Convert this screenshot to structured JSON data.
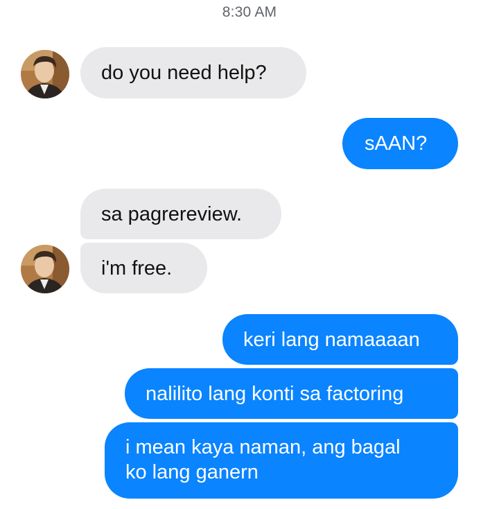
{
  "conversation": {
    "timestamp": "8:30 AM",
    "contact": {
      "avatar_icon": "profile-photo"
    },
    "colors": {
      "incoming_bubble": "#e9e9eb",
      "outgoing_bubble": "#0a84ff",
      "timestamp_text": "#5f6368"
    },
    "messages": [
      {
        "direction": "incoming",
        "text": "do you need help?"
      },
      {
        "direction": "outgoing",
        "text": "sAAN?"
      },
      {
        "direction": "incoming",
        "text": "sa pagrereview."
      },
      {
        "direction": "incoming",
        "text": "i'm free."
      },
      {
        "direction": "outgoing",
        "text": "keri lang namaaaan"
      },
      {
        "direction": "outgoing",
        "text": "nalilito lang konti sa factoring"
      },
      {
        "direction": "outgoing",
        "text_line1": "i mean kaya naman, ang bagal",
        "text_line2": "ko lang ganern"
      }
    ]
  }
}
